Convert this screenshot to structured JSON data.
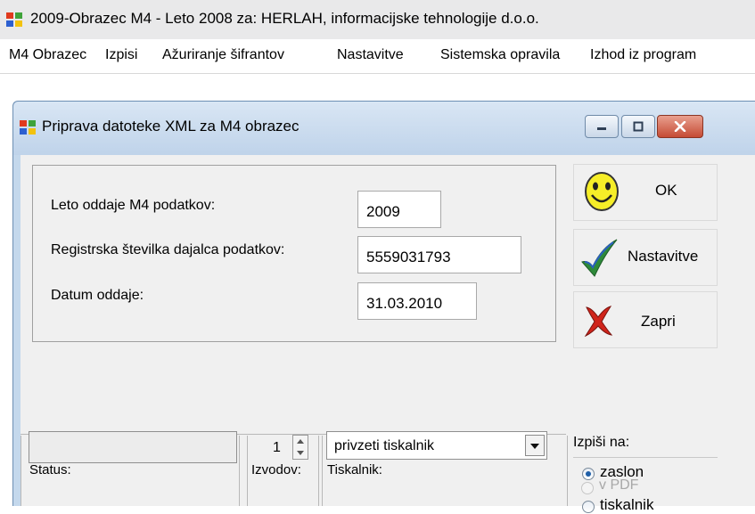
{
  "app": {
    "title": "2009-Obrazec M4 - Leto 2008 za: HERLAH, informacijske tehnologije d.o.o.",
    "icon": "windows-flag-icon"
  },
  "menu": {
    "items": [
      {
        "label": "M4 Obrazec"
      },
      {
        "label": "Izpisi"
      },
      {
        "label": "Ažuriranje šifrantov"
      },
      {
        "label": "Nastavitve"
      },
      {
        "label": "Sistemska opravila"
      },
      {
        "label": "Izhod iz program"
      }
    ]
  },
  "dialog": {
    "title": "Priprava datoteke XML za M4 obrazec",
    "icon": "windows-flag-icon",
    "minimize_icon": "minimize-icon",
    "maximize_icon": "maximize-icon",
    "close_icon": "close-icon",
    "form": {
      "year_label": "Leto oddaje M4 podatkov:",
      "year_value": "2009",
      "reg_label": "Registrska številka dajalca podatkov:",
      "reg_value": "5559031793",
      "date_label": "Datum oddaje:",
      "date_value": "31.03.2010"
    },
    "buttons": {
      "ok": {
        "label": "OK",
        "icon": "smiley-icon"
      },
      "settings": {
        "label": "Nastavitve",
        "icon": "checkmark-icon"
      },
      "close": {
        "label": "Zapri",
        "icon": "red-x-icon"
      }
    },
    "bottom": {
      "status_label": "Status:",
      "status_value": "",
      "copies_label": "Izvodov:",
      "copies_value": "1",
      "printer_label": "Tiskalnik:",
      "printer_value": "privzeti tiskalnik"
    },
    "output": {
      "label": "Izpiši na:",
      "options": [
        {
          "label": "zaslon",
          "checked": true,
          "enabled": true
        },
        {
          "label": "tiskalnik",
          "checked": false,
          "enabled": true
        },
        {
          "label": "v PDF",
          "checked": false,
          "enabled": false
        }
      ]
    },
    "colors": {
      "frame": "#c4d8ec",
      "client": "#f0f0f0",
      "close_button": "#c54b34"
    }
  }
}
